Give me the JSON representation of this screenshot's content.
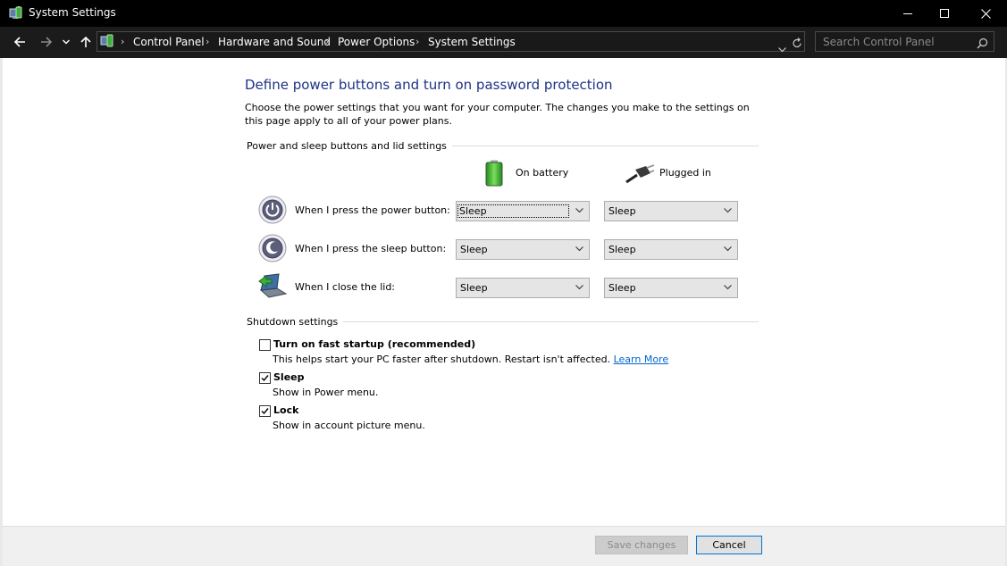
{
  "window": {
    "title": "System Settings",
    "app_icon": "power-options-icon",
    "controls": [
      "minimize-icon",
      "maximize-icon",
      "close-icon"
    ]
  },
  "address_bar": {
    "breadcrumbs": [
      "Control Panel",
      "Hardware and Sound",
      "Power Options",
      "System Settings"
    ],
    "search_placeholder": "Search Control Panel"
  },
  "page": {
    "heading": "Define power buttons and turn on password protection",
    "description": "Choose the power settings that you want for your computer. The changes you make to the settings on this page apply to all of your power plans."
  },
  "buttons_section": {
    "title": "Power and sleep buttons and lid settings",
    "columns": [
      {
        "label": "On battery",
        "icon": "battery-icon"
      },
      {
        "label": "Plugged in",
        "icon": "power-plug-icon"
      }
    ],
    "rows": [
      {
        "label": "When I press the power button:",
        "icon": "power-button-icon",
        "on_battery": "Sleep",
        "plugged_in": "Sleep"
      },
      {
        "label": "When I press the sleep button:",
        "icon": "sleep-button-icon",
        "on_battery": "Sleep",
        "plugged_in": "Sleep"
      },
      {
        "label": "When I close the lid:",
        "icon": "laptop-lid-icon",
        "on_battery": "Sleep",
        "plugged_in": "Sleep"
      }
    ]
  },
  "shutdown_section": {
    "title": "Shutdown settings",
    "items": [
      {
        "label": "Turn on fast startup (recommended)",
        "checked": false,
        "description": "This helps start your PC faster after shutdown. Restart isn't affected.",
        "link": "Learn More"
      },
      {
        "label": "Sleep",
        "checked": true,
        "description": "Show in Power menu."
      },
      {
        "label": "Lock",
        "checked": true,
        "description": "Show in account picture menu."
      }
    ]
  },
  "footer": {
    "save_label": "Save changes",
    "cancel_label": "Cancel"
  },
  "colors": {
    "heading": "#1e3287",
    "link": "#0066cc",
    "titlebar": "#000000"
  }
}
